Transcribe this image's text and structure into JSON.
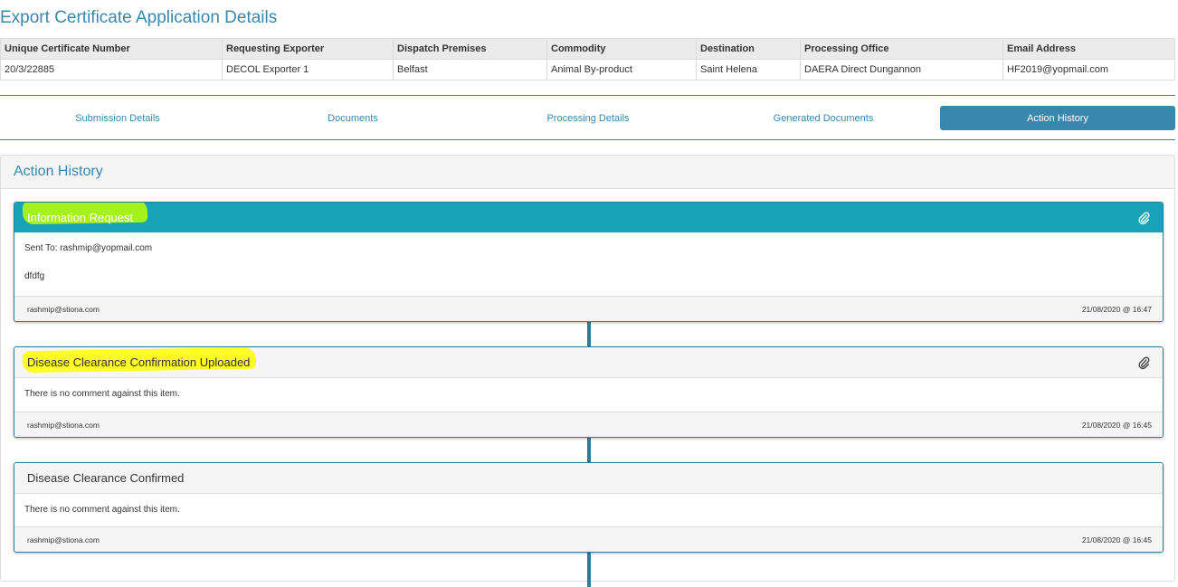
{
  "page_title": "Export Certificate Application Details",
  "summary": {
    "headers": [
      "Unique Certificate Number",
      "Requesting Exporter",
      "Dispatch Premises",
      "Commodity",
      "Destination",
      "Processing Office",
      "Email Address"
    ],
    "values": [
      "20/3/22885",
      "DECOL Exporter 1",
      "Belfast",
      "Animal By-product",
      "Saint Helena",
      "DAERA Direct Dungannon",
      "HF2019@yopmail.com"
    ]
  },
  "tabs": [
    {
      "label": "Submission Details",
      "active": false
    },
    {
      "label": "Documents",
      "active": false
    },
    {
      "label": "Processing Details",
      "active": false
    },
    {
      "label": "Generated Documents",
      "active": false
    },
    {
      "label": "Action History",
      "active": true
    }
  ],
  "panel": {
    "title": "Action History"
  },
  "history": [
    {
      "title": "Information Request",
      "style": "teal",
      "has_attachment": true,
      "highlighted": true,
      "lines": [
        "Sent To: rashmip@yopmail.com",
        "dfdfg"
      ],
      "user": "rashmip@stiona.com",
      "timestamp": "21/08/2020 @ 16:47"
    },
    {
      "title": "Disease Clearance Confirmation Uploaded",
      "style": "grey",
      "has_attachment": true,
      "highlighted": true,
      "lines": [
        "There is no comment against this item."
      ],
      "user": "rashmip@stiona.com",
      "timestamp": "21/08/2020 @ 16:45"
    },
    {
      "title": "Disease Clearance Confirmed",
      "style": "grey",
      "has_attachment": false,
      "highlighted": false,
      "lines": [
        "There is no comment against this item."
      ],
      "user": "rashmip@stiona.com",
      "timestamp": "21/08/2020 @ 16:45"
    }
  ],
  "icons": {
    "attachment": "paperclip-icon"
  },
  "colors": {
    "accent": "#3a87ad",
    "teal": "#17a2b8",
    "highlight": "#ffff00"
  }
}
